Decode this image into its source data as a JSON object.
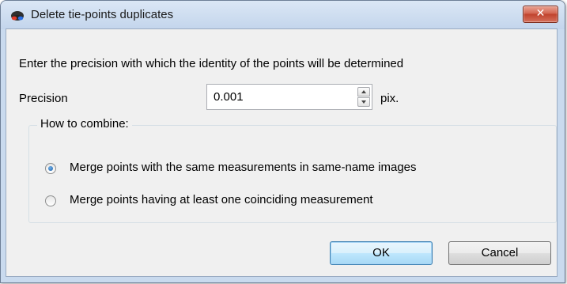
{
  "window": {
    "title": "Delete tie-points duplicates",
    "close_icon": "close-icon",
    "app_icon": "anaglyph-glasses-icon"
  },
  "instruction": "Enter the precision with which the identity of the points will be determined",
  "precision": {
    "label": "Precision",
    "value": "0.001",
    "unit": "pix."
  },
  "combine": {
    "group_title": "How to combine:",
    "options": [
      {
        "label": "Merge points with the same measurements in same-name images",
        "selected": true
      },
      {
        "label": "Merge points having at least one coinciding measurement",
        "selected": false
      }
    ]
  },
  "buttons": {
    "ok": "OK",
    "cancel": "Cancel"
  },
  "colors": {
    "title_bar": "#c3d5ec",
    "close_button": "#c0432d",
    "dialog_bg": "#f0f0f0",
    "radio_selected": "#1d5fa8"
  }
}
